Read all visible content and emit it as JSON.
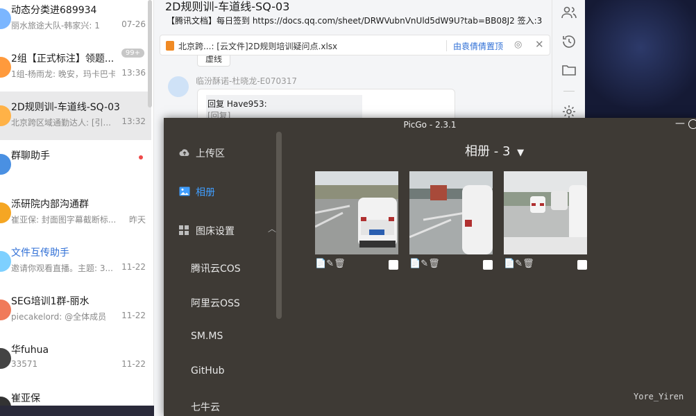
{
  "chat_list": {
    "items": [
      {
        "title": "动态分类进689934",
        "preview": "丽水旅途大队-韩家兴: 1",
        "time": "07-26",
        "avatar_color": "#7bb6ff"
      },
      {
        "title": "2组【正式标注】领题...",
        "preview": "1组-杨雨龙: 晚安，玛卡巴卡",
        "time": "13:36",
        "badge": "99+",
        "avatar_color": "#ff9a3c"
      },
      {
        "title": "2D规则训-车道线-SQ-03",
        "preview": "北京跨区域通勤达人: [引...",
        "time": "13:32",
        "avatar_color": "#ffb247"
      },
      {
        "title": "群聊助手",
        "preview": "",
        "time": "",
        "avatar_color": "#4a90e2"
      },
      {
        "title": "泺研院内部沟通群",
        "preview": "崔亚保: 封面图字幕截断标...",
        "time": "昨天",
        "avatar_color": "#f5a623"
      },
      {
        "title": "文件互传助手",
        "preview": "邀请你观看直播。主题: 3...",
        "time": "11-22",
        "avatar_color": "#7ed0ff"
      },
      {
        "title": "SEG培训1群-丽水",
        "preview": "piecakelord: @全体成员",
        "time": "11-22",
        "avatar_color": "#f07a5a"
      },
      {
        "title": "华fuhua",
        "preview": "33571",
        "time": "11-22",
        "avatar_color": "#444"
      },
      {
        "title": "崔亚保",
        "preview": "",
        "time": "",
        "avatar_color": "#333"
      }
    ]
  },
  "chat": {
    "title": "2D规则训-车道线-SQ-03",
    "doc_line": "【腾讯文档】每日签到  https://docs.qq.com/sheet/DRWVubnVnUld5dW9U?tab=BB08J2  签入:3",
    "pinned_text": "北京跨...: [云文件]2D规则培训疑问点.xlsx",
    "pinned_by": "由袁倩倩置顶",
    "prev_bubble": "虚线",
    "sender": "临汾酥诺-杜晓龙-E070317",
    "reply_text": "回复   Have953:",
    "reply_quote": "[回复]"
  },
  "picgo": {
    "window_title": "PicGo - 2.3.1",
    "nav": {
      "upload": "上传区",
      "gallery": "相册",
      "settings": "图床设置",
      "sub": [
        "腾讯云COS",
        "阿里云OSS",
        "SM.MS",
        "GitHub",
        "七牛云"
      ]
    },
    "gallery_title": "相册 - 3",
    "image_count": 3,
    "watermark": "Yore_Yiren"
  }
}
